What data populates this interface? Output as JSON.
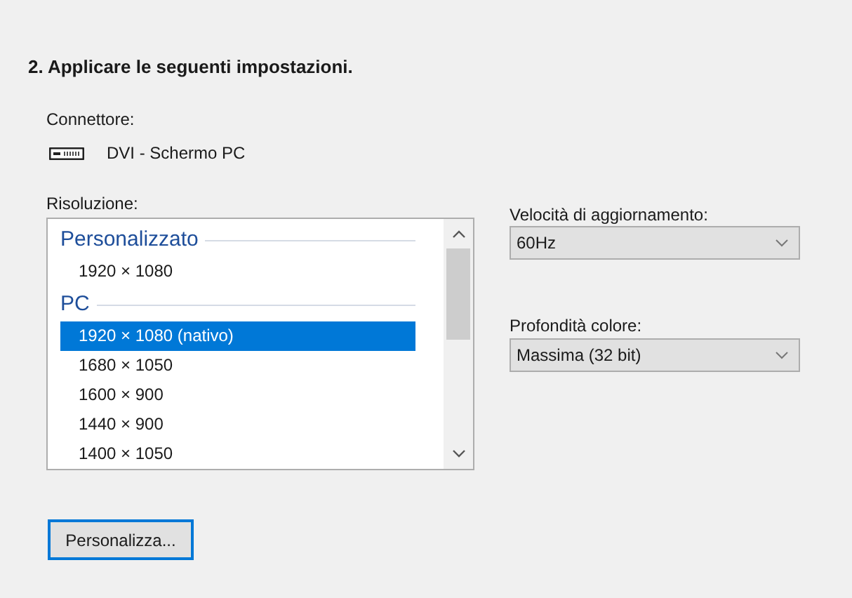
{
  "heading": "2. Applicare le seguenti impostazioni.",
  "connector": {
    "label": "Connettore:",
    "value": "DVI - Schermo PC"
  },
  "resolution": {
    "label": "Risoluzione:",
    "entries": [
      {
        "kind": "header",
        "label": "Personalizzato"
      },
      {
        "kind": "option",
        "label": "1920 × 1080",
        "selected": false
      },
      {
        "kind": "header",
        "label": "PC"
      },
      {
        "kind": "option",
        "label": "1920 × 1080 (nativo)",
        "selected": true
      },
      {
        "kind": "option",
        "label": "1680 × 1050",
        "selected": false
      },
      {
        "kind": "option",
        "label": "1600 × 900",
        "selected": false
      },
      {
        "kind": "option",
        "label": "1440 × 900",
        "selected": false
      },
      {
        "kind": "option",
        "label": "1400 × 1050",
        "selected": false
      }
    ]
  },
  "refresh_rate": {
    "label": "Velocità di aggiornamento:",
    "value": "60Hz"
  },
  "color_depth": {
    "label": "Profondità colore:",
    "value": "Massima (32 bit)"
  },
  "customize_button": "Personalizza..."
}
